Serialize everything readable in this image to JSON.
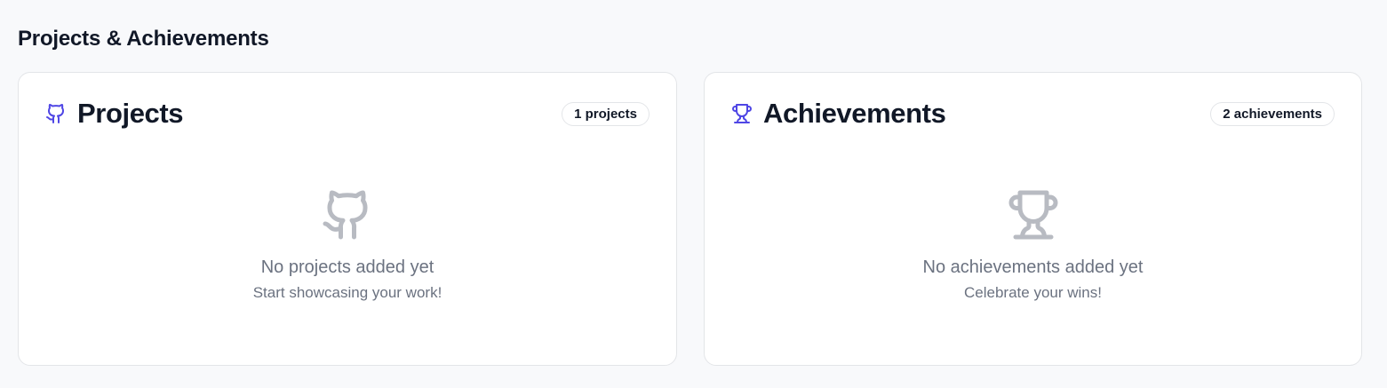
{
  "section": {
    "title": "Projects & Achievements"
  },
  "projects": {
    "title": "Projects",
    "count_label": "1 projects",
    "icon": "github-icon",
    "empty_title": "No projects added yet",
    "empty_subtitle": "Start showcasing your work!"
  },
  "achievements": {
    "title": "Achievements",
    "count_label": "2 achievements",
    "icon": "trophy-icon",
    "empty_title": "No achievements added yet",
    "empty_subtitle": "Celebrate your wins!"
  },
  "colors": {
    "accent": "#4f46e5",
    "muted_icon": "#b8bbc2",
    "muted_text": "#6b7280",
    "background": "#f8f9fb"
  }
}
